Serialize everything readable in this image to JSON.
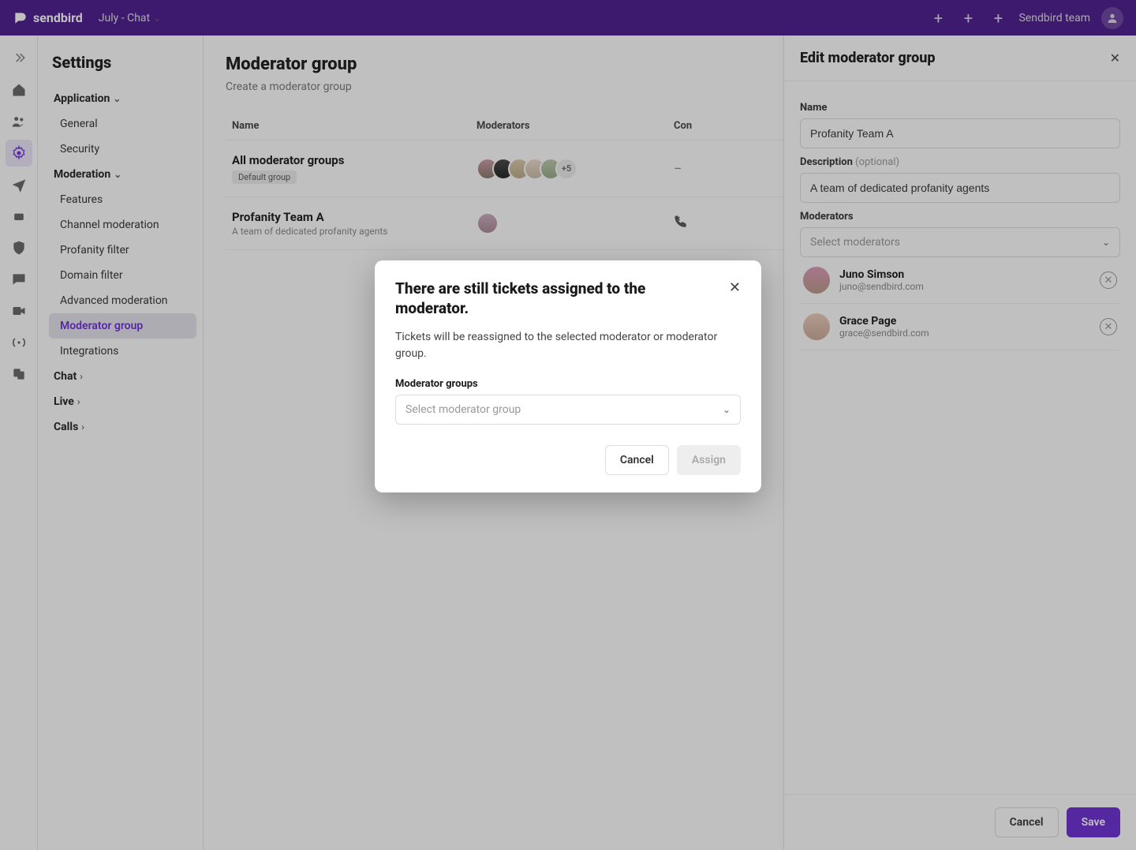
{
  "topbar": {
    "brand": "sendbird",
    "app_selector": "July - Chat",
    "team_label": "Sendbird team"
  },
  "settings": {
    "title": "Settings",
    "groups": {
      "application": {
        "label": "Application",
        "items": [
          "General",
          "Security"
        ]
      },
      "moderation": {
        "label": "Moderation",
        "items": [
          "Features",
          "Channel moderation",
          "Profanity filter",
          "Domain filter",
          "Advanced moderation",
          "Moderator group",
          "Integrations"
        ],
        "active": "Moderator group"
      },
      "chat": {
        "label": "Chat"
      },
      "live": {
        "label": "Live"
      },
      "calls": {
        "label": "Calls"
      }
    }
  },
  "page": {
    "title": "Moderator group",
    "subtitle": "Create a moderator group",
    "columns": {
      "name": "Name",
      "moderators": "Moderators",
      "con": "Con"
    },
    "rows": [
      {
        "name": "All moderator groups",
        "badge": "Default group",
        "extra_count": "+5",
        "con": "–"
      },
      {
        "name": "Profanity Team A",
        "desc": "A team of dedicated profanity agents"
      }
    ]
  },
  "drawer": {
    "title": "Edit moderator group",
    "labels": {
      "name": "Name",
      "desc": "Description",
      "desc_opt": "(optional)",
      "mods": "Moderators"
    },
    "name_value": "Profanity Team A",
    "desc_value": "A team of dedicated profanity agents",
    "select_placeholder": "Select moderators",
    "moderators": [
      {
        "name": "Juno Simson",
        "email": "juno@sendbird.com"
      },
      {
        "name": "Grace Page",
        "email": "grace@sendbird.com"
      }
    ],
    "buttons": {
      "cancel": "Cancel",
      "save": "Save"
    }
  },
  "modal": {
    "title": "There are still tickets assigned to the moderator.",
    "body": "Tickets will be reassigned to the selected moderator or moderator group.",
    "field_label": "Moderator groups",
    "select_placeholder": "Select moderator group",
    "buttons": {
      "cancel": "Cancel",
      "assign": "Assign"
    }
  }
}
